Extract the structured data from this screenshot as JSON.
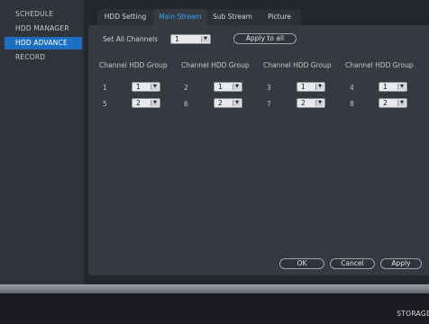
{
  "sidebar": {
    "items": [
      {
        "label": "SCHEDULE"
      },
      {
        "label": "HDD MANAGER"
      },
      {
        "label": "HDD ADVANCE",
        "active": true
      },
      {
        "label": "RECORD"
      }
    ]
  },
  "tabs": [
    {
      "label": "HDD Setting"
    },
    {
      "label": "Main Stream",
      "active": true
    },
    {
      "label": "Sub Stream"
    },
    {
      "label": "Picture"
    }
  ],
  "set_all": {
    "label": "Set All Channels",
    "value": "1",
    "apply_label": "Apply to all"
  },
  "columns": [
    {
      "channel": "Channel",
      "group": "HDD Group"
    },
    {
      "channel": "Channel",
      "group": "HDD Group"
    },
    {
      "channel": "Channel",
      "group": "HDD Group"
    },
    {
      "channel": "Channel",
      "group": "HDD Group"
    }
  ],
  "channels": [
    {
      "num": "1",
      "group": "1"
    },
    {
      "num": "2",
      "group": "1"
    },
    {
      "num": "3",
      "group": "1"
    },
    {
      "num": "4",
      "group": "1"
    },
    {
      "num": "5",
      "group": "2"
    },
    {
      "num": "6",
      "group": "2"
    },
    {
      "num": "7",
      "group": "2"
    },
    {
      "num": "8",
      "group": "2"
    }
  ],
  "buttons": {
    "ok": "OK",
    "cancel": "Cancel",
    "apply": "Apply"
  },
  "status": {
    "storage": "STORAGE"
  },
  "colors": {
    "accent": "#1d6fc2",
    "active_tab_text": "#33a4f5",
    "background": "#23262b"
  }
}
